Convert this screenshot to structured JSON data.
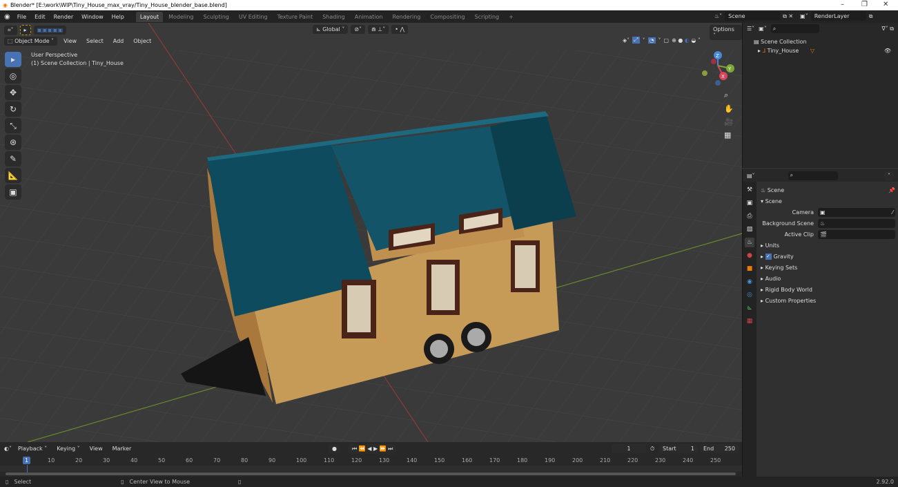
{
  "window": {
    "title": "Blender* [E:\\work\\WIP\\Tiny_House_max_vray/Tiny_House_blender_base.blend]",
    "minimize": "–",
    "restore": "❐",
    "close": "✕"
  },
  "menu": [
    "File",
    "Edit",
    "Render",
    "Window",
    "Help"
  ],
  "workspaces": [
    "Layout",
    "Modeling",
    "Sculpting",
    "UV Editing",
    "Texture Paint",
    "Shading",
    "Animation",
    "Rendering",
    "Compositing",
    "Scripting",
    "+"
  ],
  "scene": {
    "name": "Scene",
    "view_layer": "RenderLayer"
  },
  "viewport": {
    "mode": "Object Mode",
    "menus": [
      "View",
      "Select",
      "Add",
      "Object"
    ],
    "transform": "Global",
    "options": "Options",
    "perspective": "User Perspective",
    "collection": "(1) Scene Collection | Tiny_House",
    "axes": {
      "x": "X",
      "y": "Y",
      "z": "Z"
    }
  },
  "outliner": {
    "root": "Scene Collection",
    "items": [
      {
        "name": "Tiny_House"
      }
    ]
  },
  "properties": {
    "context": "Scene",
    "panel": "Scene",
    "fields": [
      {
        "label": "Camera",
        "value": ""
      },
      {
        "label": "Background Scene",
        "value": ""
      },
      {
        "label": "Active Clip",
        "value": ""
      }
    ],
    "sections": [
      "Units",
      "Gravity",
      "Keying Sets",
      "Audio",
      "Rigid Body World",
      "Custom Properties"
    ],
    "gravity_checked": true
  },
  "timeline": {
    "menus": [
      "Playback",
      "Keying",
      "View",
      "Marker"
    ],
    "current_frame": "1",
    "start_label": "Start",
    "start": "1",
    "end_label": "End",
    "end": "250",
    "ticks": [
      "10",
      "20",
      "30",
      "40",
      "50",
      "60",
      "70",
      "80",
      "90",
      "100",
      "110",
      "120",
      "130",
      "140",
      "150",
      "160",
      "170",
      "180",
      "190",
      "200",
      "210",
      "220",
      "230",
      "240",
      "250"
    ],
    "playhead": "1"
  },
  "status": {
    "select": "Select",
    "center": "Center View to Mouse",
    "version": "2.92.0"
  },
  "colors": {
    "accent": "#4772b3",
    "roof": "#0f4b5e",
    "wood": "#c79a55",
    "grid_x": "#8b3b3b",
    "grid_y": "#6a8a2a"
  }
}
